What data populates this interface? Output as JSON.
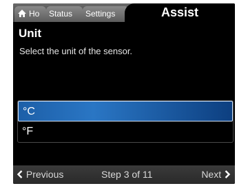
{
  "tabs": {
    "home_label": "Ho",
    "status_label": "Status",
    "settings_label": "Settings",
    "assist_label": "Assist"
  },
  "page": {
    "title": "Unit",
    "subtitle": "Select the unit of the sensor."
  },
  "options": [
    {
      "label": "°C",
      "selected": true
    },
    {
      "label": "°F",
      "selected": false
    }
  ],
  "footer": {
    "previous_label": "Previous",
    "step_label": "Step 3 of 11",
    "next_label": "Next"
  },
  "icons": {
    "home": "home-icon",
    "previous": "chevron-left-icon",
    "next": "chevron-right-icon"
  },
  "colors": {
    "background": "#000000",
    "selection": "#2a76c4",
    "text": "#ffffff"
  }
}
